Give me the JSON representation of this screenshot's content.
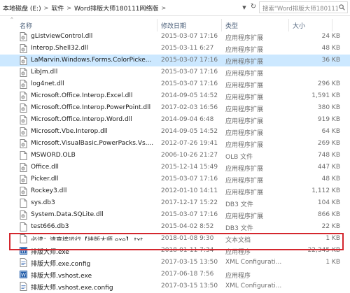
{
  "address_bar": {
    "crumbs": [
      "本地磁盘 (E:)",
      "软件",
      "Word排版大师180111网络版"
    ],
    "search_placeholder": "搜索\"Word排版大师180111网络版\""
  },
  "columns": {
    "name": "名称",
    "date": "修改日期",
    "type": "类型",
    "size": "大小"
  },
  "files": [
    {
      "name": "gListviewControl.dll",
      "date": "2015-03-07 17:16",
      "type": "应用程序扩展",
      "size": "24 KB",
      "icon": "dll-icon"
    },
    {
      "name": "Interop.Shell32.dll",
      "date": "2015-03-11 6:27",
      "type": "应用程序扩展",
      "size": "48 KB",
      "icon": "dll-icon"
    },
    {
      "name": "LaMarvin.Windows.Forms.ColorPicke...",
      "date": "2015-03-07 17:16",
      "type": "应用程序扩展",
      "size": "36 KB",
      "icon": "dll-icon",
      "selected": true
    },
    {
      "name": "LibJm.dll",
      "date": "2015-03-07 17:16",
      "type": "应用程序扩展",
      "size": "",
      "icon": "dll-icon"
    },
    {
      "name": "log4net.dll",
      "date": "2015-03-07 17:16",
      "type": "应用程序扩展",
      "size": "296 KB",
      "icon": "dll-icon"
    },
    {
      "name": "Microsoft.Office.Interop.Excel.dll",
      "date": "2014-09-05 14:52",
      "type": "应用程序扩展",
      "size": "1,591 KB",
      "icon": "dll-icon"
    },
    {
      "name": "Microsoft.Office.Interop.PowerPoint.dll",
      "date": "2017-02-03 16:56",
      "type": "应用程序扩展",
      "size": "380 KB",
      "icon": "dll-icon"
    },
    {
      "name": "Microsoft.Office.Interop.Word.dll",
      "date": "2014-09-04 6:48",
      "type": "应用程序扩展",
      "size": "919 KB",
      "icon": "dll-icon"
    },
    {
      "name": "Microsoft.Vbe.Interop.dll",
      "date": "2014-09-05 14:52",
      "type": "应用程序扩展",
      "size": "64 KB",
      "icon": "dll-icon"
    },
    {
      "name": "Microsoft.VisualBasic.PowerPacks.Vs....",
      "date": "2012-07-26 19:41",
      "type": "应用程序扩展",
      "size": "269 KB",
      "icon": "dll-icon"
    },
    {
      "name": "MSWORD.OLB",
      "date": "2006-10-26 21:27",
      "type": "OLB 文件",
      "size": "748 KB",
      "icon": "file-icon"
    },
    {
      "name": "Office.dll",
      "date": "2015-12-14 15:49",
      "type": "应用程序扩展",
      "size": "447 KB",
      "icon": "dll-icon"
    },
    {
      "name": "Picker.dll",
      "date": "2015-03-07 17:16",
      "type": "应用程序扩展",
      "size": "48 KB",
      "icon": "dll-icon"
    },
    {
      "name": "Rockey3.dll",
      "date": "2012-01-10 14:11",
      "type": "应用程序扩展",
      "size": "1,112 KB",
      "icon": "dll-icon"
    },
    {
      "name": "sys.db3",
      "date": "2017-12-17 15:22",
      "type": "DB3 文件",
      "size": "104 KB",
      "icon": "file-icon"
    },
    {
      "name": "System.Data.SQLite.dll",
      "date": "2015-03-07 17:16",
      "type": "应用程序扩展",
      "size": "866 KB",
      "icon": "dll-icon"
    },
    {
      "name": "test666.db3",
      "date": "2015-04-02 8:52",
      "type": "DB3 文件",
      "size": "22 KB",
      "icon": "file-icon"
    },
    {
      "name": "必读：请直接运行【排版大师.exe】.txt",
      "date": "2018-01-08 9:30",
      "type": "文本文档",
      "size": "1 KB",
      "icon": "file-icon",
      "clipped": true
    },
    {
      "name": "排版大师.exe",
      "date": "2018-01-11 7:34",
      "type": "应用程序",
      "size": "22,345 KB",
      "icon": "exe-icon"
    },
    {
      "name": "排版大师.exe.config",
      "date": "2017-03-15 13:50",
      "type": "XML Configurati...",
      "size": "1 KB",
      "icon": "config-icon"
    },
    {
      "name": "排版大师.vshost.exe",
      "date": "2017-06-18 7:56",
      "type": "应用程序",
      "size": "",
      "icon": "exe-icon"
    },
    {
      "name": "排版大师.vshost.exe.config",
      "date": "2017-03-15 13:50",
      "type": "XML Configurati...",
      "size": "",
      "icon": "config-icon"
    }
  ],
  "colors": {
    "selected_row": "#cce8ff",
    "highlight_border": "#d4272e",
    "exe_icon": "#1e5aa8"
  }
}
